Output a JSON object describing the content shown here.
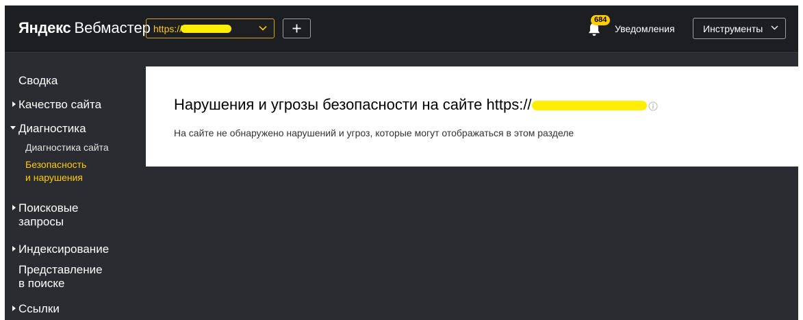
{
  "header": {
    "logo_brand": "Яндекс",
    "logo_product": "Вебмастер",
    "site_prefix": "https://",
    "notifications_count": "684",
    "notifications_label": "Уведомления",
    "tools_label": "Инструменты"
  },
  "sidebar": {
    "summary": "Сводка",
    "quality": "Качество сайта",
    "diagnostics": "Диагностика",
    "diagnostics_site": "Диагностика сайта",
    "security_line1": "Безопасность",
    "security_line2": "и нарушения",
    "search_line1": "Поисковые",
    "search_line2": "запросы",
    "indexing": "Индексирование",
    "presentation_line1": "Представление",
    "presentation_line2": "в поиске",
    "links": "Ссылки"
  },
  "main": {
    "title_prefix": "Нарушения и угрозы безопасности на сайте https://",
    "description": "На сайте не обнаружено нарушений и угроз, которые могут отображаться в этом разделе"
  },
  "colors": {
    "accent": "#ffcc00",
    "header_bg": "#1c1e22",
    "page_bg": "#2b2c31",
    "redaction": "#ffee00"
  }
}
